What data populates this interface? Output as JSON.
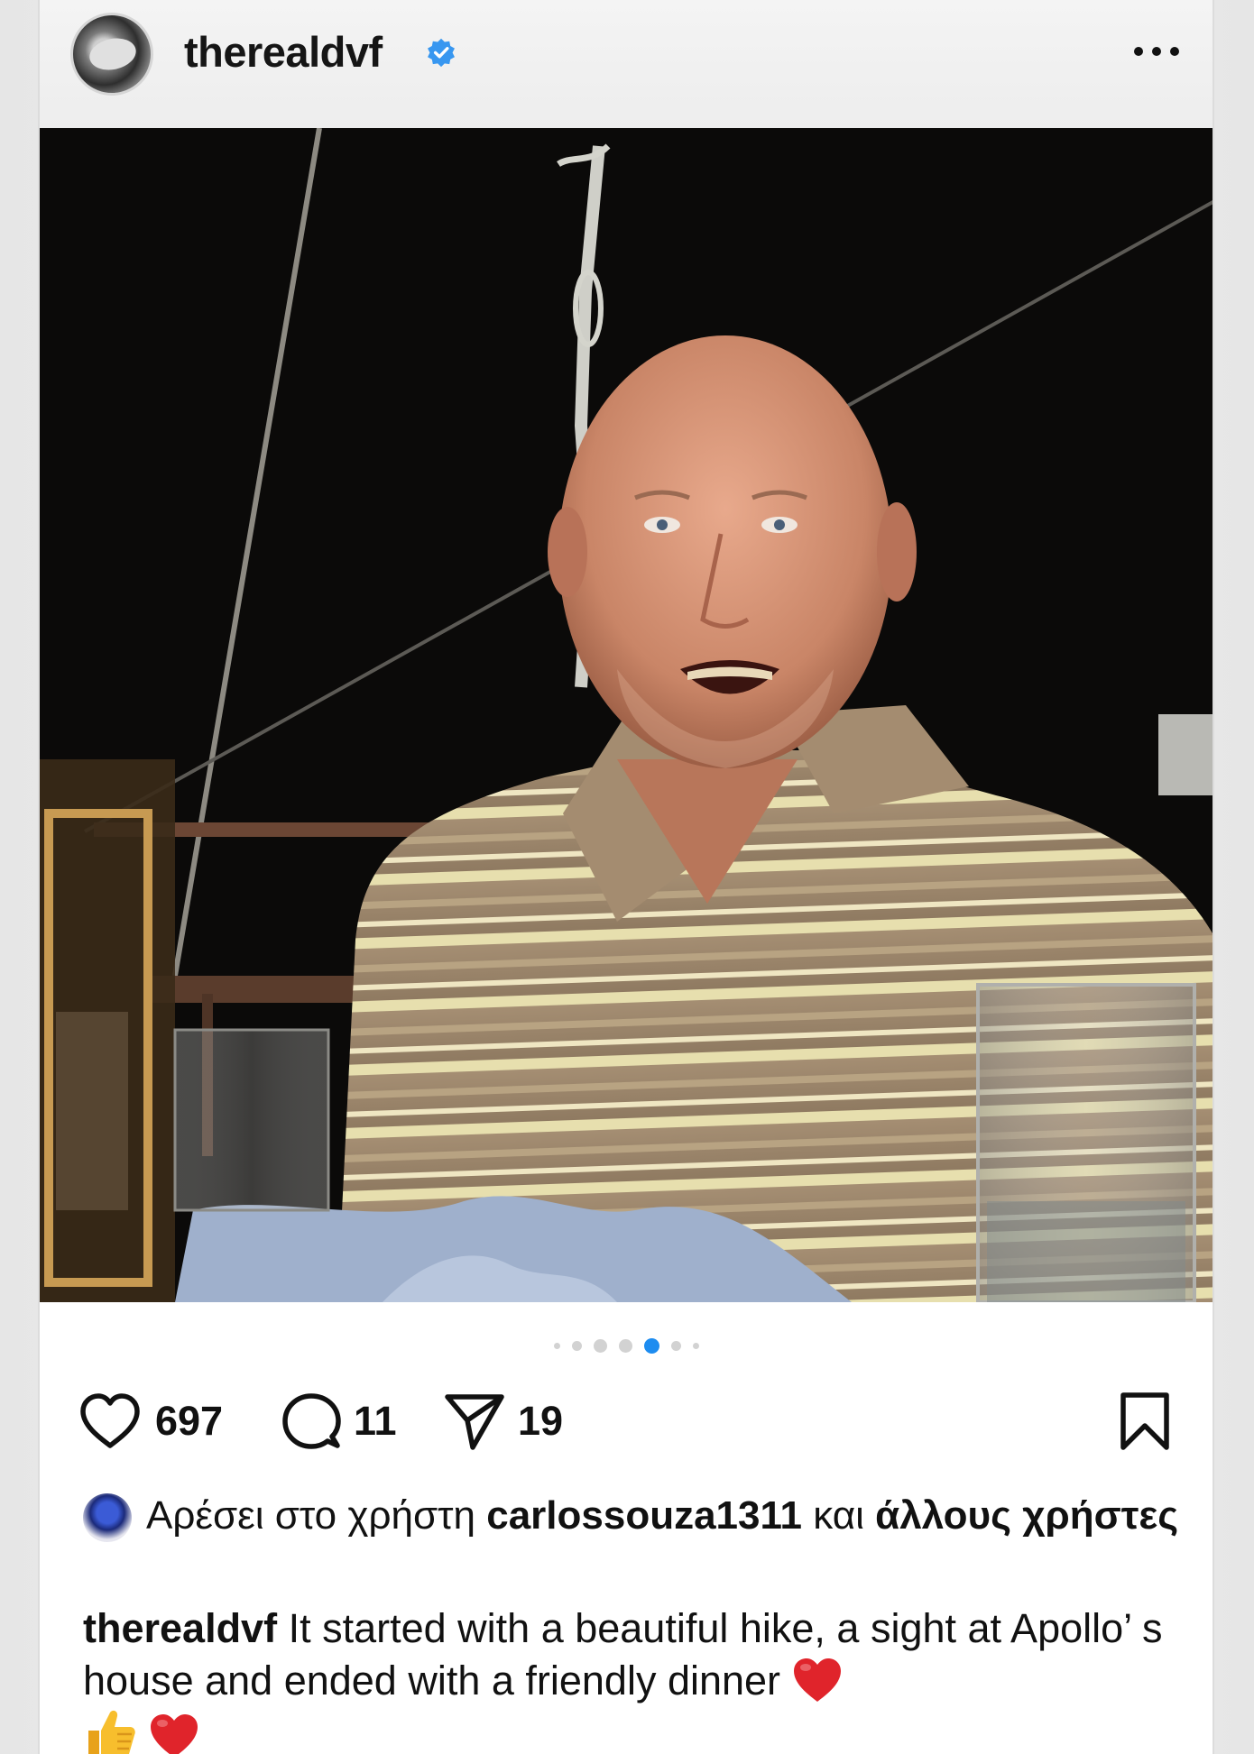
{
  "post": {
    "username": "therealdvf",
    "verified_icon": "verified-badge-icon",
    "more_icon": "more-options-icon"
  },
  "carousel": {
    "dot_count": 7,
    "active_index": 4,
    "active_color": "#1d8cf0"
  },
  "actions": {
    "likes": "697",
    "comments": "11",
    "shares": "19",
    "icons": [
      "heart-icon",
      "comment-icon",
      "share-icon",
      "bookmark-icon"
    ]
  },
  "liked_by": {
    "prefix": "Αρέσει στο χρήστη",
    "user": "carlossouza1311",
    "middle": "και",
    "others": "άλλους χρήστες"
  },
  "caption": {
    "author": "therealdvf",
    "text": "It started with a beautiful hike, a sight at Apollo’ s house and ended with a friendly dinner",
    "emojis": [
      "red-heart-emoji",
      "thumbs-up-emoji",
      "red-heart-emoji"
    ]
  },
  "colors": {
    "verified": "#3897f0",
    "heart_emoji": "#e0242b"
  }
}
